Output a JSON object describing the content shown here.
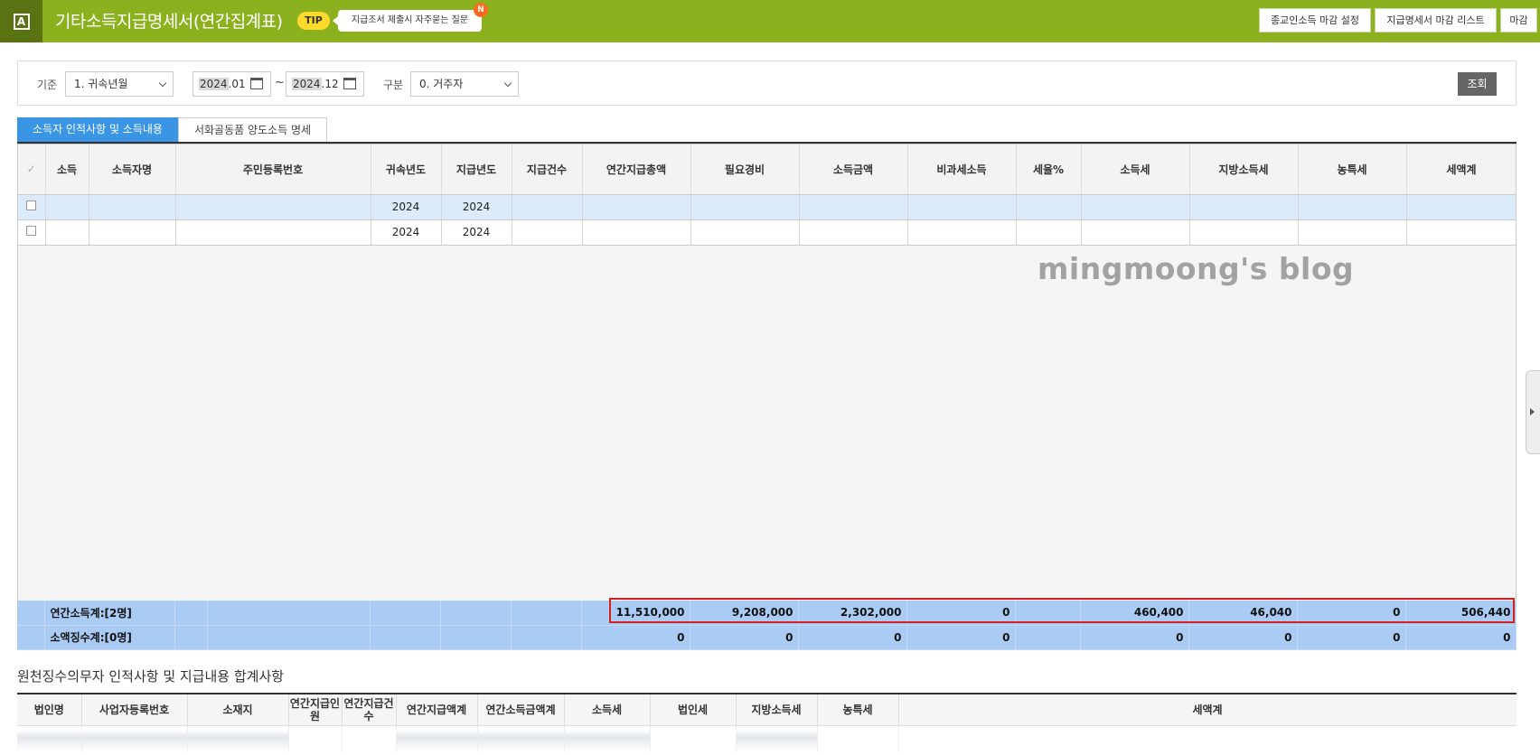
{
  "header": {
    "logo_letter": "A",
    "title": "기타소득지급명세서(연간집계표)",
    "tip_badge": "TIP",
    "tip_text": "지급조서 제출시 자주묻는 질문",
    "new_badge": "N",
    "buttons": [
      "종교인소득 마감 설정",
      "지급명세서 마감 리스트",
      "마감"
    ]
  },
  "filter": {
    "basis_label": "기준",
    "basis_value": "1. 귀속년월",
    "date_from_year": "2024",
    "date_from_rest": ".01",
    "tilde": "~",
    "date_to_year": "2024",
    "date_to_rest": ".12",
    "division_label": "구분",
    "division_value": "0. 거주자",
    "search_button": "조회"
  },
  "tabs": [
    "소득자 인적사항 및 소득내용",
    "서화골동품 양도소득 명세"
  ],
  "grid": {
    "check_header": "✓",
    "columns": [
      "소득",
      "소득자명",
      "주민등록번호",
      "귀속년도",
      "지급년도",
      "지급건수",
      "연간지급총액",
      "필요경비",
      "소득금액",
      "비과세소득",
      "세율%",
      "소득세",
      "지방소득세",
      "농특세",
      "세액계"
    ],
    "rows": [
      {
        "attribution_year": "2024",
        "payment_year": "2024"
      },
      {
        "attribution_year": "2024",
        "payment_year": "2024"
      }
    ]
  },
  "watermark": "mingmoong's blog",
  "totals": {
    "annual": {
      "label": "연간소득계:[2명]",
      "annual_total": "11,510,000",
      "necessary_expenses": "9,208,000",
      "income_amount": "2,302,000",
      "nontaxable": "0",
      "income_tax": "460,400",
      "local_income_tax": "46,040",
      "rural_tax": "0",
      "tax_total": "506,440"
    },
    "small": {
      "label": "소액징수계:[0명]",
      "annual_total": "0",
      "necessary_expenses": "0",
      "income_amount": "0",
      "nontaxable": "0",
      "income_tax": "0",
      "local_income_tax": "0",
      "rural_tax": "0",
      "tax_total": "0"
    }
  },
  "bottom": {
    "title": "원천징수의무자 인적사항 및 지급내용 합계사항",
    "columns": [
      "법인명",
      "사업자등록번호",
      "소재지",
      "연간지급인원",
      "연간지급건수",
      "연간지급액계",
      "연간소득금액계",
      "소득세",
      "법인세",
      "지방소득세",
      "농특세",
      "세액계"
    ]
  },
  "colors": {
    "header_green": "#8cb11f",
    "active_tab_blue": "#3a95e4",
    "totals_blue": "#a9cbf4",
    "highlight_red": "#d62020"
  }
}
